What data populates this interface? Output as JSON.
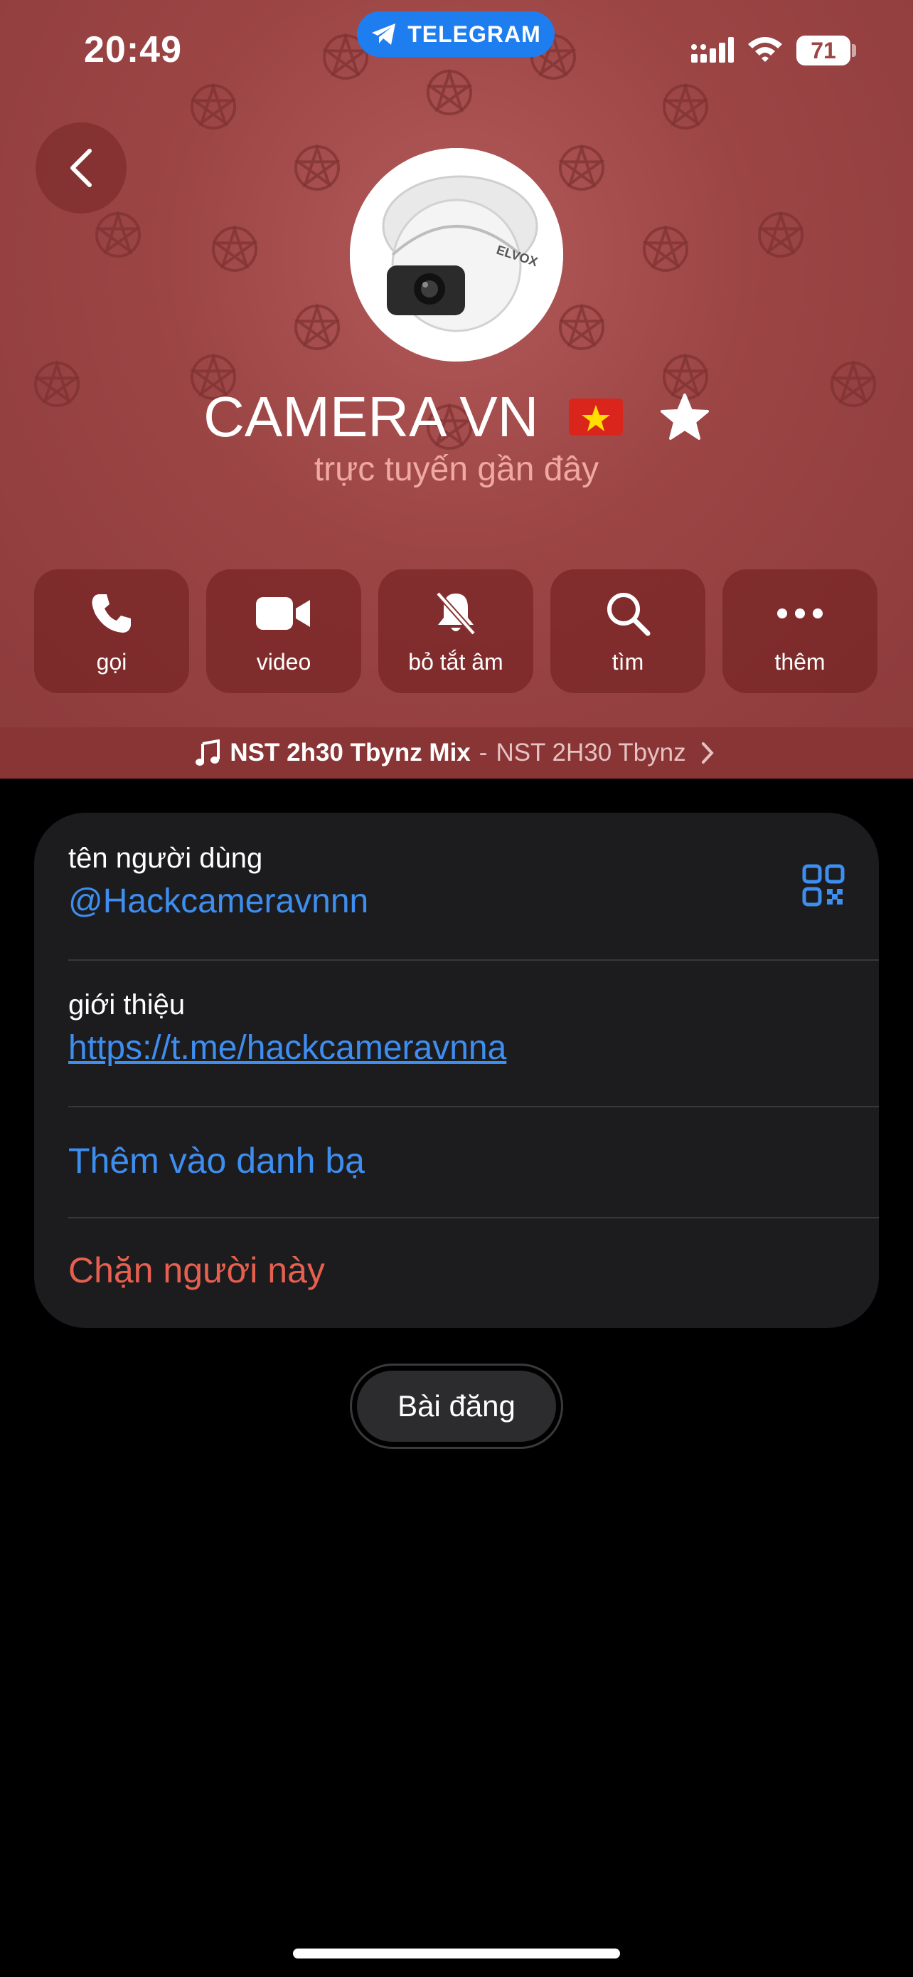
{
  "status_bar": {
    "time": "20:49",
    "app_pill": "TELEGRAM",
    "battery": "71"
  },
  "profile": {
    "name": "CAMERA VN",
    "status": "trực tuyến gần đây",
    "avatar_brand": "ELVOX"
  },
  "actions": [
    {
      "label": "gọi",
      "icon": "phone-icon"
    },
    {
      "label": "video",
      "icon": "video-icon"
    },
    {
      "label": "bỏ tắt âm",
      "icon": "bell-slash-icon"
    },
    {
      "label": "tìm",
      "icon": "search-icon"
    },
    {
      "label": "thêm",
      "icon": "more-icon"
    }
  ],
  "music": {
    "track": "NST 2h30 Tbynz Mix",
    "separator": "-",
    "artist": "NST 2H30 Tbynz"
  },
  "info": {
    "username_label": "tên người dùng",
    "username_value": "@Hackcameravnnn",
    "bio_label": "giới thiệu",
    "bio_value": "https://t.me/hackcameravnna",
    "add_contact": "Thêm vào danh bạ",
    "block_user": "Chặn người này"
  },
  "posts_button": "Bài đăng",
  "colors": {
    "header_bg": "#9c4545",
    "link_blue": "#3e8ef0",
    "danger_red": "#e7604f",
    "card_bg": "#1c1c1e",
    "telegram_blue": "#1e7ef0"
  }
}
